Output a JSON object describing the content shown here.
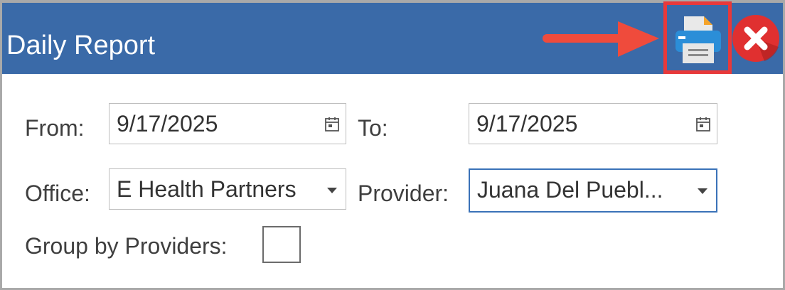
{
  "window": {
    "title": "Daily Report"
  },
  "toolbar": {
    "print_icon": "printer-icon",
    "close_icon": "close-icon",
    "highlight_color": "#e8393a",
    "accent_color": "#3a6aa8"
  },
  "form": {
    "from_label": "From:",
    "from_value": "9/17/2025",
    "to_label": "To:",
    "to_value": "9/17/2025",
    "office_label": "Office:",
    "office_value": "E Health Partners",
    "provider_label": "Provider:",
    "provider_value": "Juana Del Puebl...",
    "group_label": "Group by Providers:",
    "group_checked": false
  }
}
